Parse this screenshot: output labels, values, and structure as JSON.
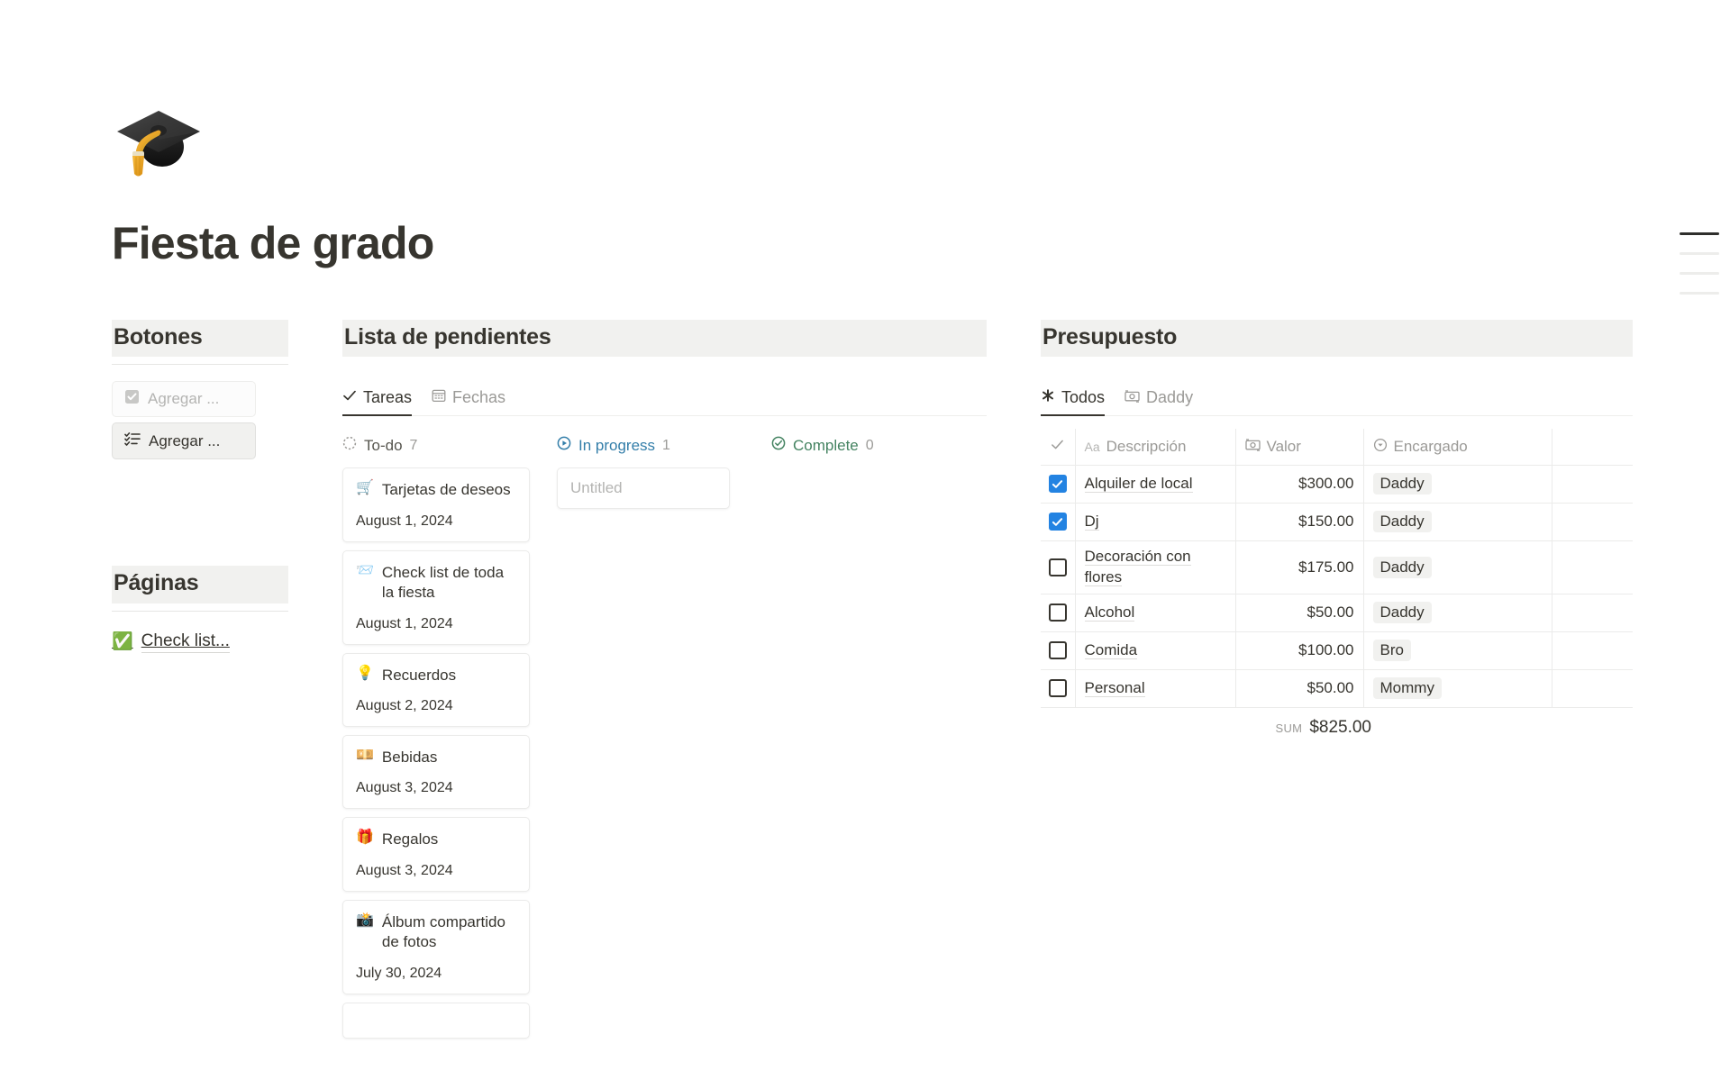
{
  "page": {
    "icon": "🎓",
    "icon_name": "graduation-cap-emoji",
    "title": "Fiesta de grado"
  },
  "botones": {
    "heading": "Botones",
    "buttons": [
      {
        "icon": "checkbox-checked-icon",
        "label": "Agregar ...",
        "style": "muted"
      },
      {
        "icon": "checklist-icon",
        "label": "Agregar ...",
        "style": "solid"
      }
    ]
  },
  "paginas": {
    "heading": "Páginas",
    "links": [
      {
        "emoji": "✅",
        "label": "Check list..."
      }
    ]
  },
  "lista": {
    "heading": "Lista de pendientes",
    "tabs": [
      {
        "icon": "check-icon",
        "label": "Tareas",
        "active": true
      },
      {
        "icon": "calendar-icon",
        "label": "Fechas",
        "active": false
      }
    ],
    "columns": [
      {
        "key": "todo",
        "name": "To-do",
        "count": "7",
        "icon": "circle-dotted-icon",
        "cards": [
          {
            "emoji": "🛒",
            "title": "Tarjetas de deseos",
            "date": "August 1, 2024"
          },
          {
            "emoji": "📨",
            "title": "Check list de toda la fiesta",
            "date": "August 1, 2024"
          },
          {
            "emoji": "💡",
            "title": "Recuerdos",
            "date": "August 2, 2024"
          },
          {
            "emoji": "💴",
            "title": "Bebidas",
            "date": "August 3, 2024"
          },
          {
            "emoji": "🎁",
            "title": "Regalos",
            "date": "August 3, 2024"
          },
          {
            "emoji": "📸",
            "title": "Álbum compartido de fotos",
            "date": "July 30, 2024"
          }
        ]
      },
      {
        "key": "inprogress",
        "name": "In progress",
        "count": "1",
        "icon": "play-circle-icon",
        "empty_card_placeholder": "Untitled"
      },
      {
        "key": "complete",
        "name": "Complete",
        "count": "0",
        "icon": "check-circle-icon"
      }
    ]
  },
  "presupuesto": {
    "heading": "Presupuesto",
    "tabs": [
      {
        "icon": "asterisk-icon",
        "label": "Todos",
        "active": true
      },
      {
        "icon": "money-icon",
        "label": "Daddy",
        "active": false
      }
    ],
    "table": {
      "headers": [
        {
          "icon": "check-icon",
          "label": ""
        },
        {
          "icon": "text-aa-icon",
          "label": "Descripción"
        },
        {
          "icon": "money-icon",
          "label": "Valor"
        },
        {
          "icon": "select-icon",
          "label": "Encargado"
        }
      ],
      "rows": [
        {
          "checked": true,
          "descripcion": "Alquiler de local",
          "valor": "$300.00",
          "encargado": "Daddy"
        },
        {
          "checked": true,
          "descripcion": "Dj",
          "valor": "$150.00",
          "encargado": "Daddy"
        },
        {
          "checked": false,
          "descripcion": "Decoración con flores",
          "valor": "$175.00",
          "encargado": "Daddy"
        },
        {
          "checked": false,
          "descripcion": "Alcohol",
          "valor": "$50.00",
          "encargado": "Daddy"
        },
        {
          "checked": false,
          "descripcion": "Comida",
          "valor": "$100.00",
          "encargado": "Bro"
        },
        {
          "checked": false,
          "descripcion": "Personal",
          "valor": "$50.00",
          "encargado": "Mommy"
        }
      ],
      "sum_label": "SUM",
      "sum_value": "$825.00"
    }
  },
  "toc": {
    "marks": [
      true,
      false,
      false,
      false
    ]
  },
  "colors": {
    "accent_blue": "#2383e2",
    "progress_blue": "#337ea9",
    "complete_green": "#448361",
    "heading_bg": "#f1f1ef",
    "text": "#37352f",
    "muted": "#9b9a97"
  }
}
